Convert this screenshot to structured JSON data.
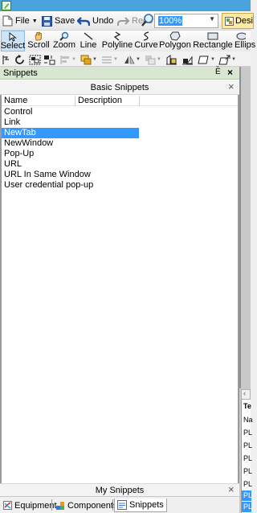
{
  "toolbar": {
    "file_label": "File",
    "save_label": "Save",
    "undo_label": "Undo",
    "redo_label": "Redo",
    "zoom_value": "100%",
    "design_label": "Desi"
  },
  "draw_tools": [
    {
      "label": "Select",
      "icon": "cursor-icon"
    },
    {
      "label": "Scroll",
      "icon": "hand-icon"
    },
    {
      "label": "Zoom",
      "icon": "magnifier-icon"
    },
    {
      "label": "Line",
      "icon": "line-icon"
    },
    {
      "label": "Polyline",
      "icon": "polyline-icon"
    },
    {
      "label": "Curve",
      "icon": "curve-icon"
    },
    {
      "label": "Polygon",
      "icon": "polygon-icon"
    },
    {
      "label": "Rectangle",
      "icon": "rectangle-icon"
    },
    {
      "label": "Ellips",
      "icon": "ellipse-icon"
    }
  ],
  "snippets": {
    "title": "Snippets",
    "pin_glyph": "Ȅ",
    "close_glyph": "×",
    "basic_title": "Basic Snippets",
    "columns": [
      "Name",
      "Description"
    ],
    "items": [
      "Control",
      "Link",
      "NewTab",
      "NewWindow",
      "Pop-Up",
      "URL",
      "URL In Same Window",
      "User credential pop-up"
    ],
    "selected_item": "NewTab",
    "my_title": "My Snippets"
  },
  "bottom_tabs": [
    {
      "label": "Equipment",
      "icon": "equipment-icon",
      "active": false
    },
    {
      "label": "Components",
      "icon": "components-icon",
      "active": false
    },
    {
      "label": "Snippets",
      "icon": "snippets-icon",
      "active": true
    }
  ],
  "right_panel": {
    "header": "Te",
    "cells": [
      "Na",
      "PL",
      "PL",
      "PL",
      "PL",
      "PL",
      "PL",
      "PL",
      "PL"
    ]
  },
  "colors": {
    "selection": "#3399ff",
    "pane_header": "#d9e6d1",
    "design_tab": "#fde9a6"
  }
}
